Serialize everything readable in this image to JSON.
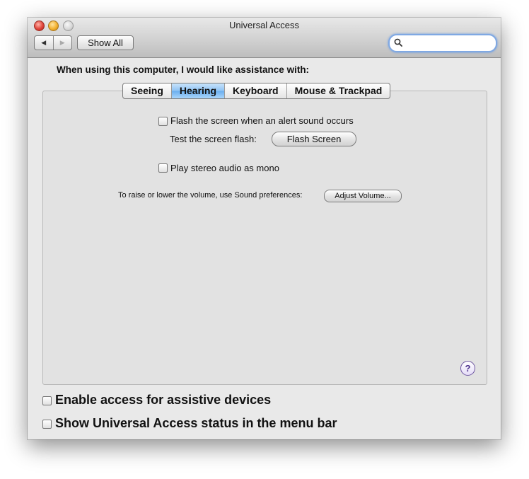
{
  "window": {
    "title": "Universal Access"
  },
  "toolbar": {
    "back_glyph": "◀",
    "forward_glyph": "▶",
    "show_all": "Show All",
    "search_placeholder": ""
  },
  "main": {
    "prompt": "When using this computer, I would like assistance with:",
    "tabs": [
      {
        "label": "Seeing"
      },
      {
        "label": "Hearing",
        "selected": true
      },
      {
        "label": "Keyboard"
      },
      {
        "label": "Mouse & Trackpad"
      }
    ],
    "hearing": {
      "flash_label": "Flash the screen when an alert sound occurs",
      "flash_checked": false,
      "test_label": "Test the screen flash:",
      "flash_button": "Flash Screen",
      "mono_label": "Play stereo audio as mono",
      "mono_checked": false,
      "volume_label": "To raise or lower the volume, use Sound preferences:",
      "adjust_button": "Adjust Volume..."
    },
    "help_glyph": "?"
  },
  "footer": {
    "assistive_label": "Enable access for assistive devices",
    "assistive_checked": false,
    "status_label": "Show Universal Access status in the menu bar",
    "status_checked": false
  },
  "colors": {
    "active_tab": "#8ec3f4",
    "search_focus": "#7fa8e3",
    "help_purple": "#4a2f8a"
  }
}
